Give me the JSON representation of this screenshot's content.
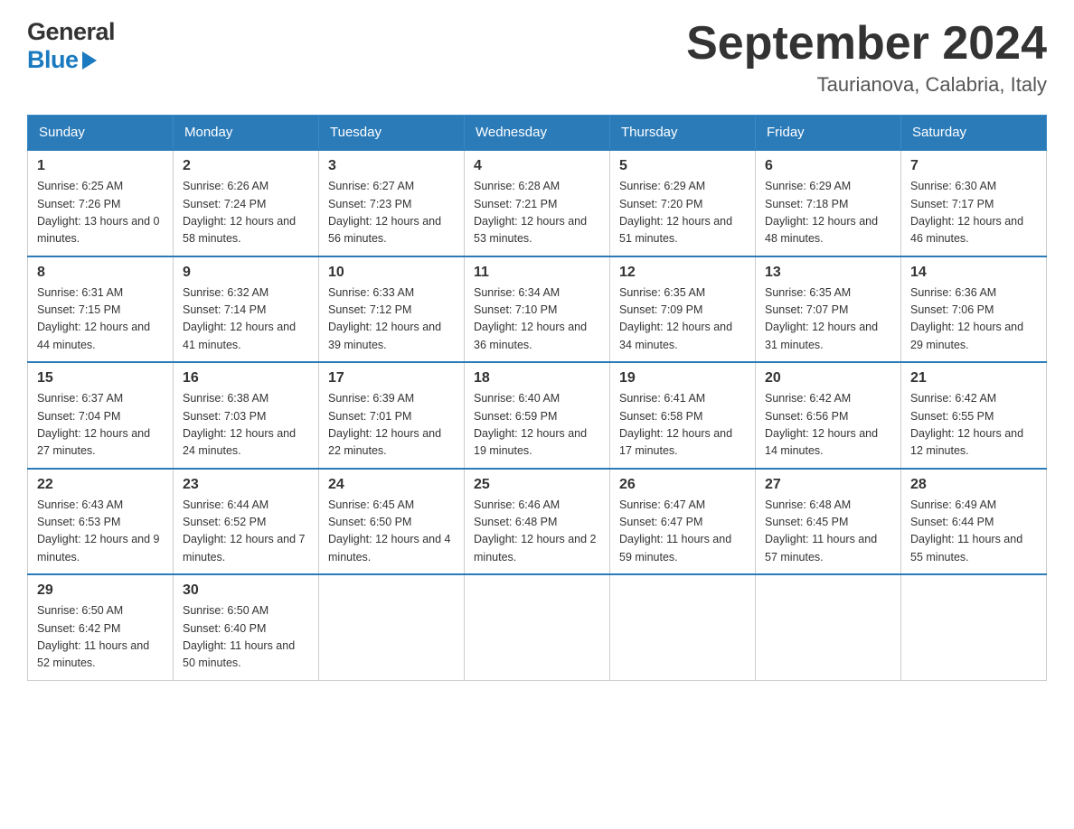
{
  "header": {
    "logo_line1": "General",
    "logo_line2": "Blue",
    "month_title": "September 2024",
    "location": "Taurianova, Calabria, Italy"
  },
  "columns": [
    "Sunday",
    "Monday",
    "Tuesday",
    "Wednesday",
    "Thursday",
    "Friday",
    "Saturday"
  ],
  "weeks": [
    [
      {
        "day": "1",
        "sunrise": "Sunrise: 6:25 AM",
        "sunset": "Sunset: 7:26 PM",
        "daylight": "Daylight: 13 hours and 0 minutes."
      },
      {
        "day": "2",
        "sunrise": "Sunrise: 6:26 AM",
        "sunset": "Sunset: 7:24 PM",
        "daylight": "Daylight: 12 hours and 58 minutes."
      },
      {
        "day": "3",
        "sunrise": "Sunrise: 6:27 AM",
        "sunset": "Sunset: 7:23 PM",
        "daylight": "Daylight: 12 hours and 56 minutes."
      },
      {
        "day": "4",
        "sunrise": "Sunrise: 6:28 AM",
        "sunset": "Sunset: 7:21 PM",
        "daylight": "Daylight: 12 hours and 53 minutes."
      },
      {
        "day": "5",
        "sunrise": "Sunrise: 6:29 AM",
        "sunset": "Sunset: 7:20 PM",
        "daylight": "Daylight: 12 hours and 51 minutes."
      },
      {
        "day": "6",
        "sunrise": "Sunrise: 6:29 AM",
        "sunset": "Sunset: 7:18 PM",
        "daylight": "Daylight: 12 hours and 48 minutes."
      },
      {
        "day": "7",
        "sunrise": "Sunrise: 6:30 AM",
        "sunset": "Sunset: 7:17 PM",
        "daylight": "Daylight: 12 hours and 46 minutes."
      }
    ],
    [
      {
        "day": "8",
        "sunrise": "Sunrise: 6:31 AM",
        "sunset": "Sunset: 7:15 PM",
        "daylight": "Daylight: 12 hours and 44 minutes."
      },
      {
        "day": "9",
        "sunrise": "Sunrise: 6:32 AM",
        "sunset": "Sunset: 7:14 PM",
        "daylight": "Daylight: 12 hours and 41 minutes."
      },
      {
        "day": "10",
        "sunrise": "Sunrise: 6:33 AM",
        "sunset": "Sunset: 7:12 PM",
        "daylight": "Daylight: 12 hours and 39 minutes."
      },
      {
        "day": "11",
        "sunrise": "Sunrise: 6:34 AM",
        "sunset": "Sunset: 7:10 PM",
        "daylight": "Daylight: 12 hours and 36 minutes."
      },
      {
        "day": "12",
        "sunrise": "Sunrise: 6:35 AM",
        "sunset": "Sunset: 7:09 PM",
        "daylight": "Daylight: 12 hours and 34 minutes."
      },
      {
        "day": "13",
        "sunrise": "Sunrise: 6:35 AM",
        "sunset": "Sunset: 7:07 PM",
        "daylight": "Daylight: 12 hours and 31 minutes."
      },
      {
        "day": "14",
        "sunrise": "Sunrise: 6:36 AM",
        "sunset": "Sunset: 7:06 PM",
        "daylight": "Daylight: 12 hours and 29 minutes."
      }
    ],
    [
      {
        "day": "15",
        "sunrise": "Sunrise: 6:37 AM",
        "sunset": "Sunset: 7:04 PM",
        "daylight": "Daylight: 12 hours and 27 minutes."
      },
      {
        "day": "16",
        "sunrise": "Sunrise: 6:38 AM",
        "sunset": "Sunset: 7:03 PM",
        "daylight": "Daylight: 12 hours and 24 minutes."
      },
      {
        "day": "17",
        "sunrise": "Sunrise: 6:39 AM",
        "sunset": "Sunset: 7:01 PM",
        "daylight": "Daylight: 12 hours and 22 minutes."
      },
      {
        "day": "18",
        "sunrise": "Sunrise: 6:40 AM",
        "sunset": "Sunset: 6:59 PM",
        "daylight": "Daylight: 12 hours and 19 minutes."
      },
      {
        "day": "19",
        "sunrise": "Sunrise: 6:41 AM",
        "sunset": "Sunset: 6:58 PM",
        "daylight": "Daylight: 12 hours and 17 minutes."
      },
      {
        "day": "20",
        "sunrise": "Sunrise: 6:42 AM",
        "sunset": "Sunset: 6:56 PM",
        "daylight": "Daylight: 12 hours and 14 minutes."
      },
      {
        "day": "21",
        "sunrise": "Sunrise: 6:42 AM",
        "sunset": "Sunset: 6:55 PM",
        "daylight": "Daylight: 12 hours and 12 minutes."
      }
    ],
    [
      {
        "day": "22",
        "sunrise": "Sunrise: 6:43 AM",
        "sunset": "Sunset: 6:53 PM",
        "daylight": "Daylight: 12 hours and 9 minutes."
      },
      {
        "day": "23",
        "sunrise": "Sunrise: 6:44 AM",
        "sunset": "Sunset: 6:52 PM",
        "daylight": "Daylight: 12 hours and 7 minutes."
      },
      {
        "day": "24",
        "sunrise": "Sunrise: 6:45 AM",
        "sunset": "Sunset: 6:50 PM",
        "daylight": "Daylight: 12 hours and 4 minutes."
      },
      {
        "day": "25",
        "sunrise": "Sunrise: 6:46 AM",
        "sunset": "Sunset: 6:48 PM",
        "daylight": "Daylight: 12 hours and 2 minutes."
      },
      {
        "day": "26",
        "sunrise": "Sunrise: 6:47 AM",
        "sunset": "Sunset: 6:47 PM",
        "daylight": "Daylight: 11 hours and 59 minutes."
      },
      {
        "day": "27",
        "sunrise": "Sunrise: 6:48 AM",
        "sunset": "Sunset: 6:45 PM",
        "daylight": "Daylight: 11 hours and 57 minutes."
      },
      {
        "day": "28",
        "sunrise": "Sunrise: 6:49 AM",
        "sunset": "Sunset: 6:44 PM",
        "daylight": "Daylight: 11 hours and 55 minutes."
      }
    ],
    [
      {
        "day": "29",
        "sunrise": "Sunrise: 6:50 AM",
        "sunset": "Sunset: 6:42 PM",
        "daylight": "Daylight: 11 hours and 52 minutes."
      },
      {
        "day": "30",
        "sunrise": "Sunrise: 6:50 AM",
        "sunset": "Sunset: 6:40 PM",
        "daylight": "Daylight: 11 hours and 50 minutes."
      },
      null,
      null,
      null,
      null,
      null
    ]
  ]
}
